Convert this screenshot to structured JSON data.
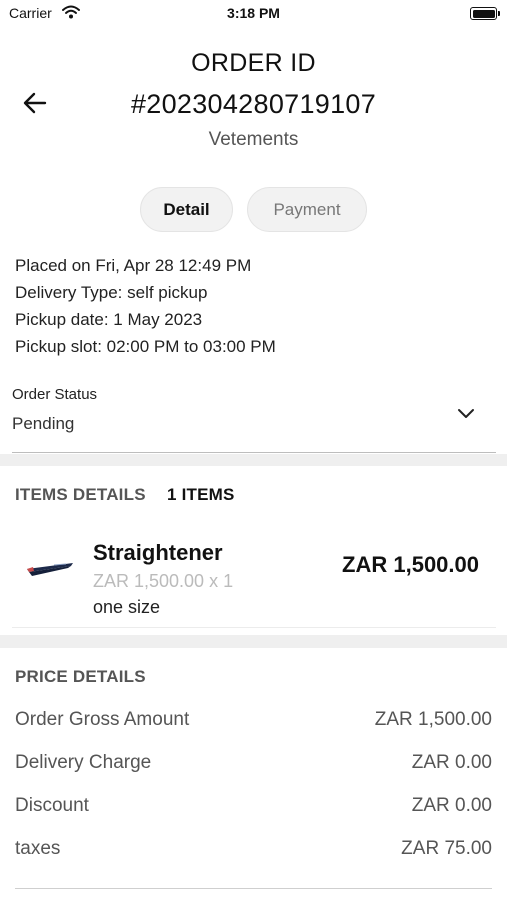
{
  "status_bar": {
    "carrier": "Carrier",
    "time": "3:18 PM",
    "icons": [
      "wifi-icon",
      "battery-icon"
    ]
  },
  "header": {
    "title_line1": "ORDER ID",
    "title_line2": "#202304280719107",
    "store_name": "Vetements",
    "back_icon": "arrow-left-icon"
  },
  "tabs": [
    {
      "label": "Detail",
      "active": true
    },
    {
      "label": "Payment",
      "active": false
    }
  ],
  "order_info": {
    "placed": "Placed on Fri, Apr 28 12:49 PM",
    "delivery_type": "Delivery Type: self pickup",
    "pickup_date": "Pickup date: 1 May 2023",
    "pickup_slot": "Pickup slot: 02:00 PM to 03:00 PM"
  },
  "order_status": {
    "label": "Order Status",
    "value": "Pending",
    "dropdown_icon": "chevron-down-icon"
  },
  "items": {
    "heading": "ITEMS DETAILS",
    "count": "1 ITEMS",
    "list": [
      {
        "name": "Straightener",
        "unit_price": "ZAR 1,500.00 x 1",
        "size": "one size",
        "total": "ZAR 1,500.00",
        "image_icon": "hair-straightener-image"
      }
    ]
  },
  "price_details": {
    "heading": "PRICE DETAILS",
    "rows": [
      {
        "label": "Order Gross Amount",
        "value": "ZAR 1,500.00"
      },
      {
        "label": "Delivery Charge",
        "value": "ZAR 0.00"
      },
      {
        "label": "Discount",
        "value": "ZAR 0.00"
      },
      {
        "label": "taxes",
        "value": "ZAR 75.00"
      }
    ]
  },
  "colors": {
    "background": "#ffffff",
    "section_band": "#efefef",
    "tab_background": "#f2f2f2",
    "muted_text": "#555555",
    "faint_text": "#bbbbbb"
  }
}
